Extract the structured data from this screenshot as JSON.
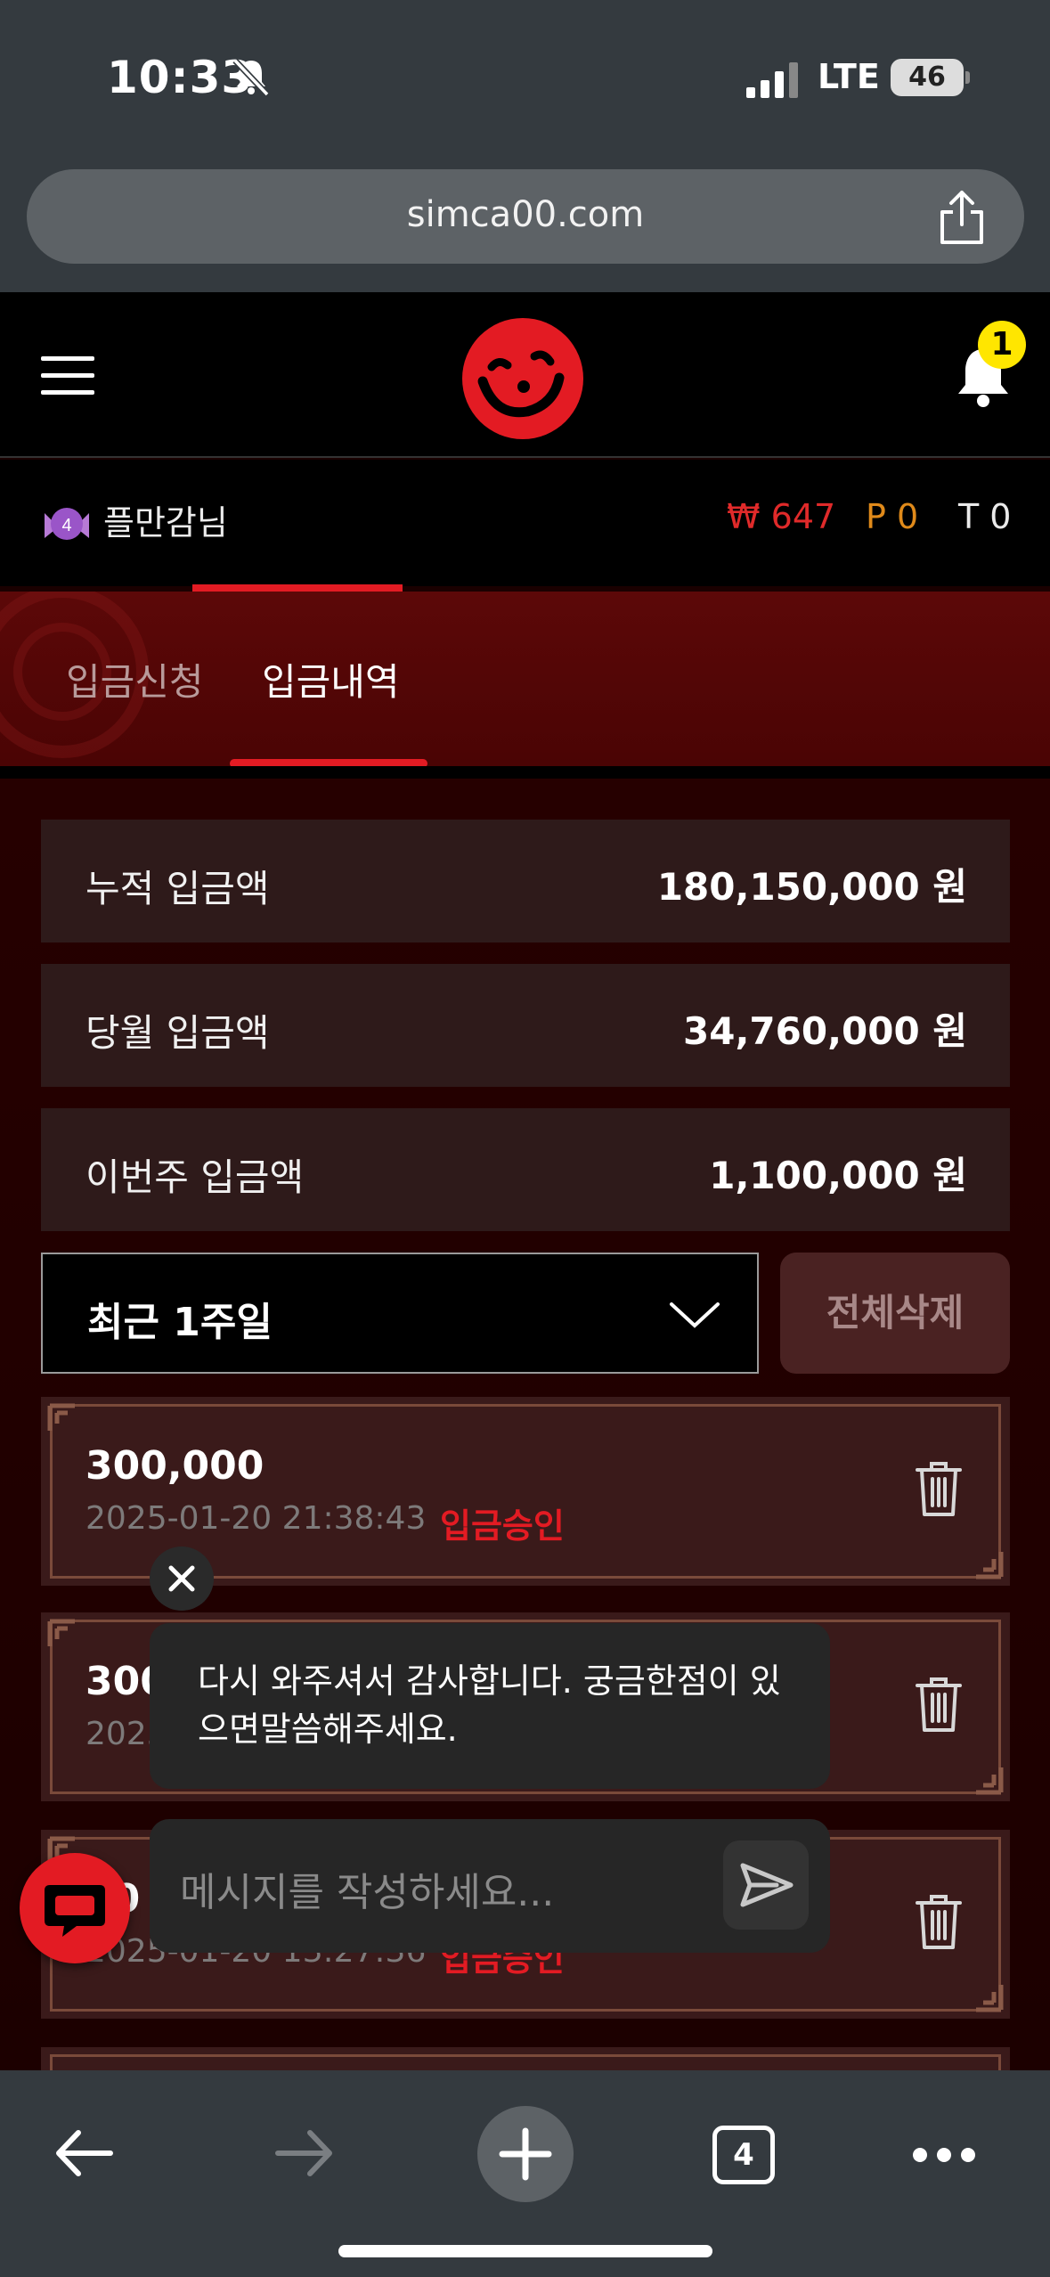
{
  "status_bar": {
    "time": "10:33",
    "network": "LTE",
    "battery": "46"
  },
  "browser": {
    "url": "simca00.com",
    "tab_count": "4"
  },
  "header": {
    "notification_count": "1"
  },
  "user": {
    "level": "4",
    "name": "플만감님",
    "balance": "₩ 647",
    "points": "P 0",
    "tickets": "T 0"
  },
  "tabs": [
    {
      "label": "입금신청",
      "active": false
    },
    {
      "label": "입금내역",
      "active": true
    }
  ],
  "summary": [
    {
      "label": "누적 입금액",
      "value": "180,150,000 원"
    },
    {
      "label": "당월 입금액",
      "value": "34,760,000 원"
    },
    {
      "label": "이번주 입금액",
      "value": "1,100,000 원"
    }
  ],
  "filter": {
    "period": "최근 1주일",
    "delete_all": "전체삭제"
  },
  "records": [
    {
      "amount": "300,000",
      "datetime": "2025-01-20 21:38:43",
      "status": "입금승인"
    },
    {
      "amount": "300",
      "datetime": "2025",
      "status": ""
    },
    {
      "amount": "00",
      "datetime": "2025-01-20 13:27:36",
      "status": "입금승인"
    }
  ],
  "chat": {
    "message": "다시 와주셔서 감사합니다. 궁금한점이 있으면말씀해주세요.",
    "input_placeholder": "메시지를 작성하세요..."
  },
  "colors": {
    "accent": "#e31b23",
    "points": "#e08a1a",
    "badge": "#ffe600"
  }
}
